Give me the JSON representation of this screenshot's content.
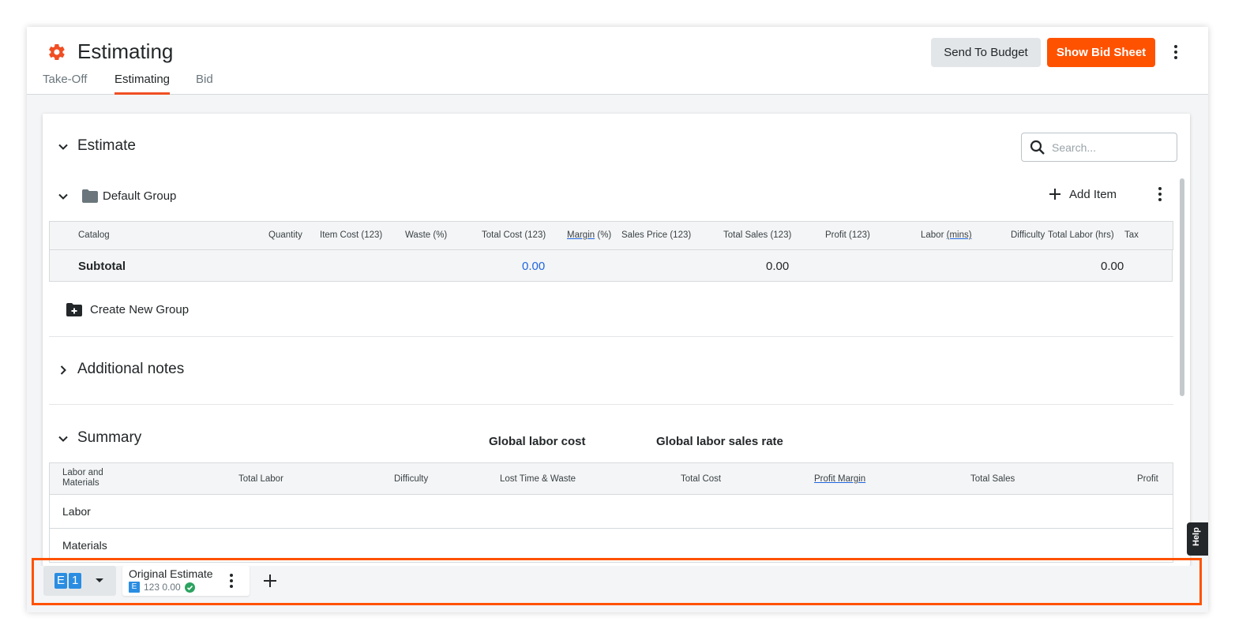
{
  "header": {
    "title": "Estimating",
    "tabs": [
      {
        "label": "Take-Off"
      },
      {
        "label": "Estimating"
      },
      {
        "label": "Bid"
      }
    ],
    "send_to_budget_label": "Send To Budget",
    "show_bid_sheet_label": "Show Bid Sheet"
  },
  "estimate": {
    "title": "Estimate",
    "search_placeholder": "Search...",
    "group": {
      "name": "Default Group",
      "add_item_label": "Add Item",
      "columns": [
        "Catalog",
        "Quantity",
        "Item Cost (123)",
        "Waste (%)",
        "Total Cost (123)",
        "Margin",
        "(%)",
        "Sales Price (123)",
        "Total Sales (123)",
        "Profit (123)",
        "Labor",
        "(mins)",
        "Difficulty",
        "Total Labor (hrs)",
        "Tax"
      ],
      "subtotal": {
        "label": "Subtotal",
        "total_cost": "0.00",
        "total_sales": "0.00",
        "total_labor": "0.00"
      }
    },
    "create_group_label": "Create New Group"
  },
  "additional_notes": {
    "title": "Additional notes"
  },
  "summary": {
    "title": "Summary",
    "global_labor_cost_label": "Global labor cost",
    "global_labor_sales_rate_label": "Global labor sales rate",
    "columns": [
      "Labor and Materials",
      "Total Labor",
      "Difficulty",
      "Lost Time & Waste",
      "Total Cost",
      "Profit Margin",
      "Total Sales",
      "Profit"
    ],
    "rows": [
      {
        "label": "Labor"
      },
      {
        "label": "Materials"
      }
    ]
  },
  "footer": {
    "selector_chip_letter": "E",
    "selector_chip_number": "1",
    "estimate_tab": {
      "name": "Original Estimate",
      "chip": "E",
      "meta": "123 0.00"
    }
  },
  "help_label": "Help",
  "colors": {
    "brand_orange": "#ff5200",
    "link_blue": "#2066df",
    "chip_blue": "#2a8de2",
    "success_green": "#2ba35f"
  }
}
